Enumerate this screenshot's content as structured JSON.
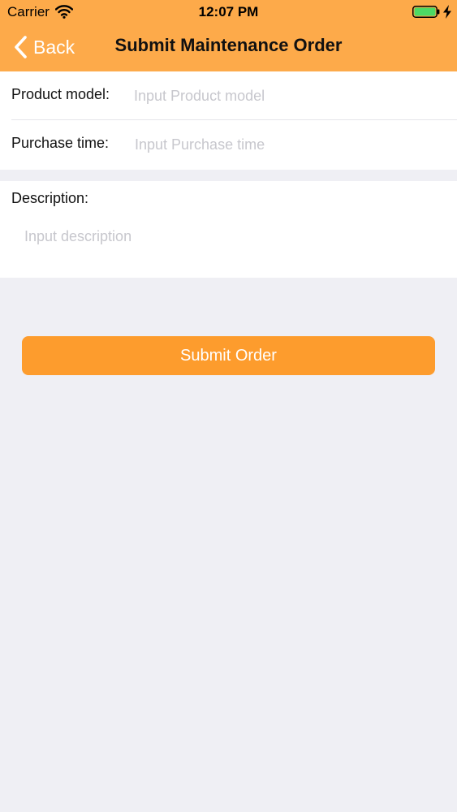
{
  "status_bar": {
    "carrier": "Carrier",
    "time": "12:07 PM",
    "wifi_icon": "wifi-icon",
    "battery_icon": "battery-charging-icon",
    "battery_color": "#4cd964"
  },
  "nav": {
    "back_label": "Back",
    "back_icon": "chevron-left-icon",
    "title": "Submit Maintenance Order",
    "bar_color": "#fdaa4a"
  },
  "form": {
    "product_model": {
      "label": "Product model:",
      "placeholder": "Input Product model",
      "value": ""
    },
    "purchase_time": {
      "label": "Purchase time:",
      "placeholder": "Input Purchase time",
      "value": ""
    },
    "description": {
      "label": "Description:",
      "placeholder": "Input description",
      "value": ""
    }
  },
  "submit": {
    "label": "Submit Order",
    "color": "#fd9c2d"
  }
}
